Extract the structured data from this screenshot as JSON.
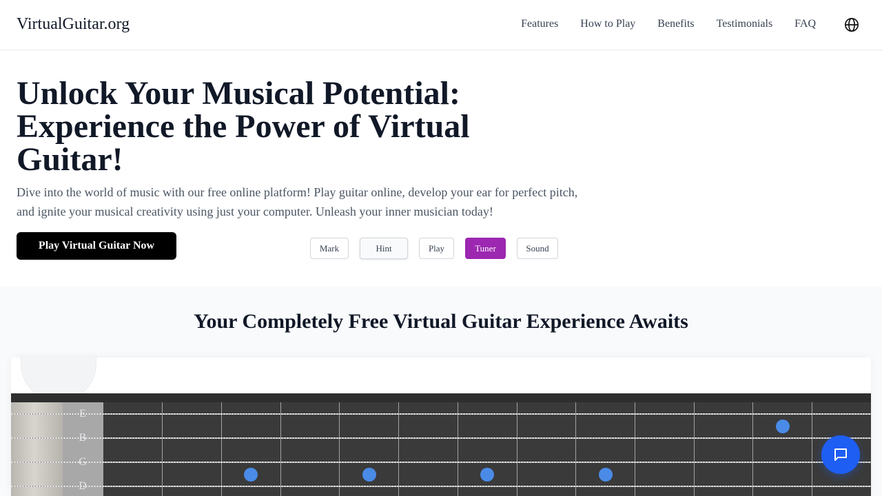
{
  "header": {
    "logo": "VirtualGuitar.org",
    "nav": [
      "Features",
      "How to Play",
      "Benefits",
      "Testimonials",
      "FAQ"
    ],
    "language_icon": "globe-icon"
  },
  "hero": {
    "title": "Unlock Your Musical Potential: Experience the Power of Virtual Guitar!",
    "subtitle": "Dive into the world of music with our free online platform! Play guitar online, develop your ear for perfect pitch, and ignite your musical creativity using just your computer. Unleash your inner musician today!",
    "cta": "Play Virtual Guitar Now"
  },
  "controls": {
    "mark": "Mark",
    "hint": "Hint",
    "play": "Play",
    "tuner": "Tuner",
    "sound": "Sound",
    "active": "Tuner",
    "active_color": "#9c27b0"
  },
  "section": {
    "title": "Your Completely Free Virtual Guitar Experience Awaits"
  },
  "fretboard": {
    "strings": [
      "E",
      "B",
      "G",
      "D"
    ],
    "dot_color": "#4a8be8"
  },
  "chat": {
    "icon": "chat-bubble-icon",
    "color": "#1e5ef3"
  }
}
